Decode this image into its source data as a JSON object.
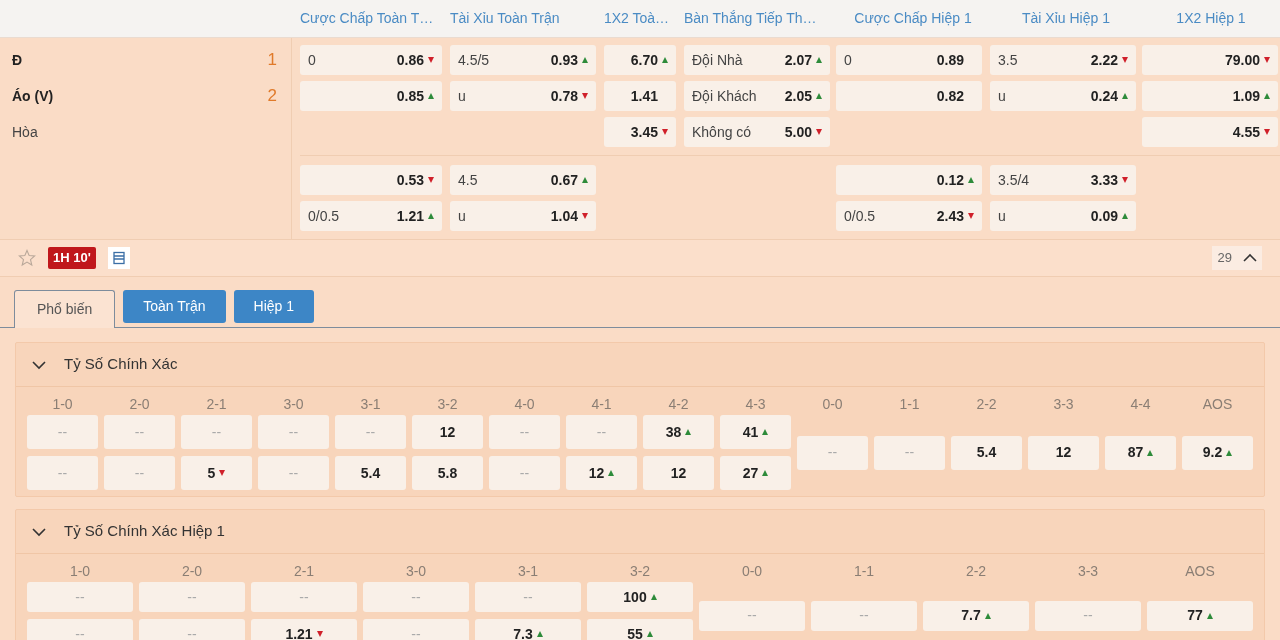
{
  "markets": {
    "columns": [
      "Cược Chấp Toàn T…",
      "Tài Xỉu Toàn Trận",
      "1X2 Toà…",
      "Bàn Thắng Tiếp Th…",
      "Cược Chấp Hiệp 1",
      "Tài Xỉu Hiệp 1",
      "1X2 Hiệp 1"
    ],
    "teams": [
      {
        "name": "Đ",
        "number": "1"
      },
      {
        "name": "Áo (V)",
        "number": "2"
      },
      {
        "name": "Hòa"
      }
    ],
    "groups": [
      {
        "rows": [
          [
            {
              "kind": "odds",
              "label": "0",
              "odds": "0.86",
              "rising": false
            },
            {
              "kind": "odds",
              "label": "4.5/5",
              "odds": "0.93",
              "rising": true
            },
            {
              "kind": "odds",
              "odds": "6.70",
              "rising": true
            },
            {
              "kind": "odds",
              "label": "Đội Nhà",
              "odds": "2.07",
              "rising": true
            },
            {
              "kind": "odds",
              "label": "0",
              "odds": "0.89"
            },
            {
              "kind": "odds",
              "label": "3.5",
              "odds": "2.22",
              "rising": false
            },
            {
              "kind": "odds",
              "odds": "79.00",
              "rising": false
            }
          ],
          [
            {
              "kind": "odds",
              "odds": "0.85",
              "rising": true
            },
            {
              "kind": "odds",
              "label": "u",
              "odds": "0.78",
              "rising": false
            },
            {
              "kind": "odds",
              "odds": "1.41"
            },
            {
              "kind": "odds",
              "label": "Đội Khách",
              "odds": "2.05",
              "rising": true
            },
            {
              "kind": "odds",
              "odds": "0.82"
            },
            {
              "kind": "odds",
              "label": "u",
              "odds": "0.24",
              "rising": true
            },
            {
              "kind": "odds",
              "odds": "1.09",
              "rising": true
            }
          ],
          [
            {
              "kind": "empty"
            },
            {
              "kind": "empty"
            },
            {
              "kind": "odds",
              "odds": "3.45",
              "rising": false
            },
            {
              "kind": "odds",
              "label": "Không có",
              "odds": "5.00",
              "rising": false
            },
            {
              "kind": "empty"
            },
            {
              "kind": "empty"
            },
            {
              "kind": "odds",
              "odds": "4.55",
              "rising": false
            }
          ]
        ]
      },
      {
        "rows": [
          [
            {
              "kind": "odds",
              "odds": "0.53",
              "rising": false
            },
            {
              "kind": "odds",
              "label": "4.5",
              "odds": "0.67",
              "rising": true
            },
            {
              "kind": "empty"
            },
            {
              "kind": "empty"
            },
            {
              "kind": "odds",
              "odds": "0.12",
              "rising": true
            },
            {
              "kind": "odds",
              "label": "3.5/4",
              "odds": "3.33",
              "rising": false
            },
            {
              "kind": "empty"
            }
          ],
          [
            {
              "kind": "odds",
              "label": "0/0.5",
              "odds": "1.21",
              "rising": true
            },
            {
              "kind": "odds",
              "label": "u",
              "odds": "1.04",
              "rising": false
            },
            {
              "kind": "empty"
            },
            {
              "kind": "empty"
            },
            {
              "kind": "odds",
              "label": "0/0.5",
              "odds": "2.43",
              "rising": false
            },
            {
              "kind": "odds",
              "label": "u",
              "odds": "0.09",
              "rising": true
            },
            {
              "kind": "empty"
            }
          ]
        ]
      }
    ]
  },
  "match_bar": {
    "favorite": false,
    "live_time": "1H 10'",
    "market_count": "29"
  },
  "tabs": [
    {
      "label": "Phổ biến",
      "selected": true
    },
    {
      "label": "Toàn Trận",
      "selected": false
    },
    {
      "label": "Hiệp 1",
      "selected": false
    }
  ],
  "sections": [
    {
      "title": "Tỷ Số Chính Xác",
      "expanded": true,
      "columns": [
        {
          "label": "1-0",
          "kind": "pair",
          "values": [
            {
              "odds": "--"
            },
            {
              "odds": "--"
            }
          ]
        },
        {
          "label": "2-0",
          "kind": "pair",
          "values": [
            {
              "odds": "--"
            },
            {
              "odds": "--"
            }
          ]
        },
        {
          "label": "2-1",
          "kind": "pair",
          "values": [
            {
              "odds": "--"
            },
            {
              "odds": "5",
              "rising": false
            }
          ]
        },
        {
          "label": "3-0",
          "kind": "pair",
          "values": [
            {
              "odds": "--"
            },
            {
              "odds": "--"
            }
          ]
        },
        {
          "label": "3-1",
          "kind": "pair",
          "values": [
            {
              "odds": "--"
            },
            {
              "odds": "5.4"
            }
          ]
        },
        {
          "label": "3-2",
          "kind": "pair",
          "values": [
            {
              "odds": "12"
            },
            {
              "odds": "5.8"
            }
          ]
        },
        {
          "label": "4-0",
          "kind": "pair",
          "values": [
            {
              "odds": "--"
            },
            {
              "odds": "--"
            }
          ]
        },
        {
          "label": "4-1",
          "kind": "pair",
          "values": [
            {
              "odds": "--"
            },
            {
              "odds": "12",
              "rising": true
            }
          ]
        },
        {
          "label": "4-2",
          "kind": "pair",
          "values": [
            {
              "odds": "38",
              "rising": true
            },
            {
              "odds": "12"
            }
          ]
        },
        {
          "label": "4-3",
          "kind": "pair",
          "values": [
            {
              "odds": "41",
              "rising": true
            },
            {
              "odds": "27",
              "rising": true
            }
          ]
        },
        {
          "label": "0-0",
          "kind": "single",
          "values": [
            {
              "odds": "--"
            }
          ]
        },
        {
          "label": "1-1",
          "kind": "single",
          "values": [
            {
              "odds": "--"
            }
          ]
        },
        {
          "label": "2-2",
          "kind": "single",
          "values": [
            {
              "odds": "5.4"
            }
          ]
        },
        {
          "label": "3-3",
          "kind": "single",
          "values": [
            {
              "odds": "12"
            }
          ]
        },
        {
          "label": "4-4",
          "kind": "single",
          "values": [
            {
              "odds": "87",
              "rising": true
            }
          ]
        },
        {
          "label": "AOS",
          "kind": "single",
          "values": [
            {
              "odds": "9.2",
              "rising": true
            }
          ]
        }
      ]
    },
    {
      "title": "Tỷ Số Chính Xác Hiệp 1",
      "expanded": true,
      "columns": [
        {
          "label": "1-0",
          "kind": "pair",
          "values": [
            {
              "odds": "--"
            },
            {
              "odds": "--"
            }
          ]
        },
        {
          "label": "2-0",
          "kind": "pair",
          "values": [
            {
              "odds": "--"
            },
            {
              "odds": "--"
            }
          ]
        },
        {
          "label": "2-1",
          "kind": "pair",
          "values": [
            {
              "odds": "--"
            },
            {
              "odds": "1.21",
              "rising": false
            }
          ]
        },
        {
          "label": "3-0",
          "kind": "pair",
          "values": [
            {
              "odds": "--"
            },
            {
              "odds": "--"
            }
          ]
        },
        {
          "label": "3-1",
          "kind": "pair",
          "values": [
            {
              "odds": "--"
            },
            {
              "odds": "7.3",
              "rising": true
            }
          ]
        },
        {
          "label": "3-2",
          "kind": "pair",
          "values": [
            {
              "odds": "100",
              "rising": true
            },
            {
              "odds": "55",
              "rising": true
            }
          ]
        },
        {
          "label": "0-0",
          "kind": "single",
          "values": [
            {
              "odds": "--"
            }
          ]
        },
        {
          "label": "1-1",
          "kind": "single",
          "values": [
            {
              "odds": "--"
            }
          ]
        },
        {
          "label": "2-2",
          "kind": "single",
          "values": [
            {
              "odds": "7.7",
              "rising": true
            }
          ]
        },
        {
          "label": "3-3",
          "kind": "single",
          "values": [
            {
              "odds": "--"
            }
          ]
        },
        {
          "label": "AOS",
          "kind": "single",
          "values": [
            {
              "odds": "77",
              "rising": true
            }
          ]
        }
      ]
    }
  ]
}
